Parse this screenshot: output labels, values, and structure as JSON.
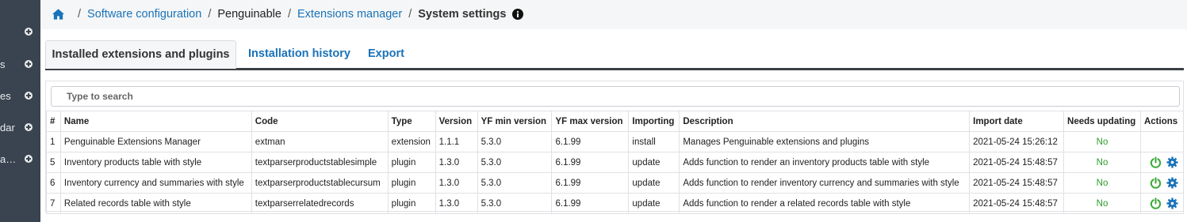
{
  "sidebar": {
    "items": [
      {
        "label": ""
      },
      {
        "label": "s"
      },
      {
        "label": "es"
      },
      {
        "label": "dar"
      },
      {
        "label": "a…"
      }
    ]
  },
  "breadcrumb": {
    "items": [
      "Software configuration",
      "Penguinable",
      "Extensions manager"
    ],
    "current": "System settings",
    "separator": "/"
  },
  "tabs": [
    "Installed extensions and plugins",
    "Installation history",
    "Export"
  ],
  "search": {
    "placeholder": "Type to search",
    "value": ""
  },
  "table": {
    "headers": [
      "#",
      "Name",
      "Code",
      "Type",
      "Version",
      "YF min version",
      "YF max version",
      "Importing",
      "Description",
      "Import date",
      "Needs updating",
      "Actions"
    ],
    "rows": [
      {
        "num": "1",
        "name": "Penguinable Extensions Manager",
        "code": "extman",
        "type": "extension",
        "version": "1.1.1",
        "yf_min": "5.3.0",
        "yf_max": "6.1.99",
        "importing": "install",
        "description": "Manages Penguinable extensions and plugins",
        "import_date": "2021-05-24 15:26:12",
        "needs_updating": "No",
        "actions": []
      },
      {
        "num": "5",
        "name": "Inventory products table with style",
        "code": "textparserproductstablesimple",
        "type": "plugin",
        "version": "1.3.0",
        "yf_min": "5.3.0",
        "yf_max": "6.1.99",
        "importing": "update",
        "description": "Adds function to render an inventory products table with style",
        "import_date": "2021-05-24 15:48:57",
        "needs_updating": "No",
        "actions": [
          "power-icon",
          "gear-icon"
        ]
      },
      {
        "num": "6",
        "name": "Inventory currency and summaries with style",
        "code": "textparserproductstablecursum",
        "type": "plugin",
        "version": "1.3.0",
        "yf_min": "5.3.0",
        "yf_max": "6.1.99",
        "importing": "update",
        "description": "Adds function to render inventory currency and summaries with style",
        "import_date": "2021-05-24 15:48:57",
        "needs_updating": "No",
        "actions": [
          "power-icon",
          "gear-icon"
        ]
      },
      {
        "num": "7",
        "name": "Related records table with style",
        "code": "textparserrelatedrecords",
        "type": "plugin",
        "version": "1.3.0",
        "yf_min": "5.3.0",
        "yf_max": "6.1.99",
        "importing": "update",
        "description": "Adds function to render a related records table with style",
        "import_date": "2021-05-24 15:48:57",
        "needs_updating": "No",
        "actions": [
          "power-icon",
          "gear-icon"
        ]
      }
    ]
  },
  "colors": {
    "sidebar_bg": "#3a4450",
    "link": "#1a73b8",
    "success": "#2a9d2a",
    "power": "#3aaa35",
    "gear": "#1a73b8"
  }
}
